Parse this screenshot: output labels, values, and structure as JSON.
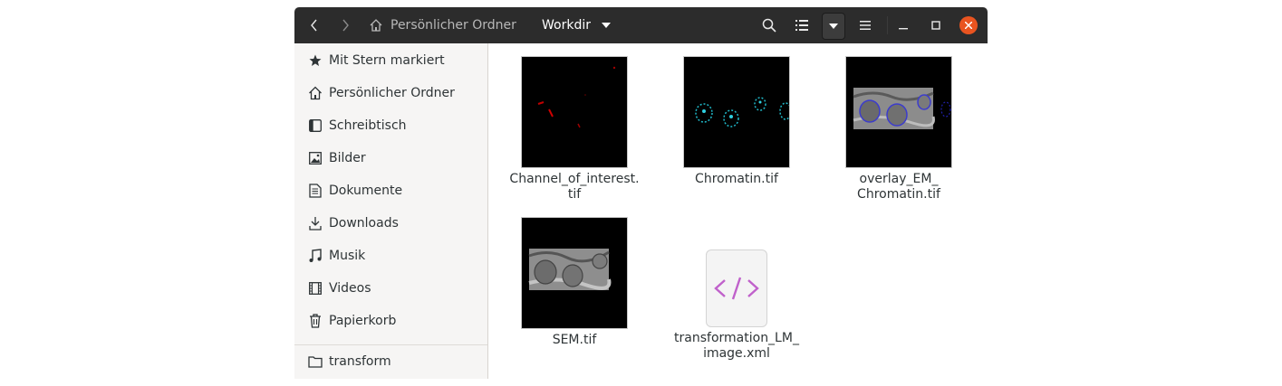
{
  "headerbar": {
    "home_crumb": "Persönlicher Ordner",
    "current_crumb": "Workdir"
  },
  "sidebar": {
    "items": [
      {
        "label": "Mit Stern markiert",
        "icon": "star-icon"
      },
      {
        "label": "Persönlicher Ordner",
        "icon": "home-icon"
      },
      {
        "label": "Schreibtisch",
        "icon": "desktop-icon"
      },
      {
        "label": "Bilder",
        "icon": "pictures-icon"
      },
      {
        "label": "Dokumente",
        "icon": "documents-icon"
      },
      {
        "label": "Downloads",
        "icon": "download-icon"
      },
      {
        "label": "Musik",
        "icon": "music-icon"
      },
      {
        "label": "Videos",
        "icon": "video-icon"
      },
      {
        "label": "Papierkorb",
        "icon": "trash-icon"
      }
    ],
    "bookmarks": [
      {
        "label": "transform",
        "icon": "folder-icon"
      }
    ]
  },
  "files": [
    {
      "name": "Channel_of_interest.\ntif"
    },
    {
      "name": "Chromatin.tif"
    },
    {
      "name": "overlay_EM_\nChromatin.tif"
    },
    {
      "name": "SEM.tif"
    },
    {
      "name": "transformation_LM_\nimage.xml"
    }
  ],
  "colors": {
    "accent": "#e95420",
    "headerbar": "#2c2c2c",
    "xml": "#c061cb"
  }
}
